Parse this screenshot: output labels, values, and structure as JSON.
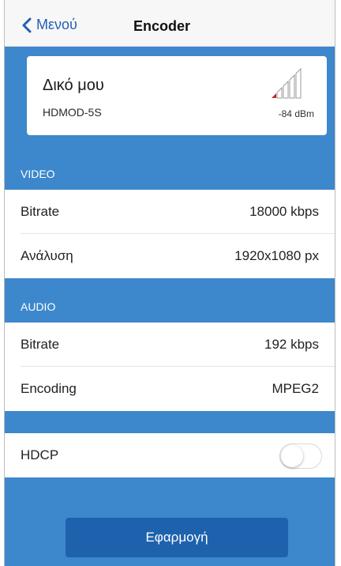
{
  "navbar": {
    "back_label": "Μενού",
    "title": "Encoder"
  },
  "device": {
    "name": "Δικό μου",
    "model": "HDMOD-5S",
    "signal_text": "-84 dBm",
    "signal_bars_active": 1,
    "signal_bars_total": 5
  },
  "video": {
    "header": "VIDEO",
    "rows": [
      {
        "label": "Bitrate",
        "value": "18000 kbps"
      },
      {
        "label": "Ανάλυση",
        "value": "1920x1080 px"
      }
    ]
  },
  "audio": {
    "header": "AUDIO",
    "rows": [
      {
        "label": "Bitrate",
        "value": "192 kbps"
      },
      {
        "label": "Encoding",
        "value": "MPEG2"
      }
    ]
  },
  "hdcp": {
    "label": "HDCP",
    "enabled": false
  },
  "apply_label": "Εφαρμογή",
  "colors": {
    "background": "#3d87cc",
    "accent": "#1f5fb7",
    "button": "#1e62ae",
    "signal_active": "#d0202a"
  }
}
